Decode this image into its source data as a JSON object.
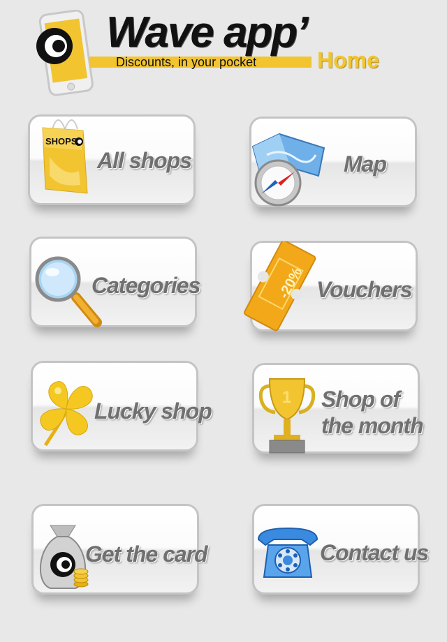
{
  "header": {
    "brand_title": "Wave app’",
    "tagline": "Discounts, in your pocket",
    "page_label": "Home",
    "accent_color": "#f2c430"
  },
  "tiles": [
    {
      "label": "All  shops",
      "icon": "shopping-bag-icon",
      "bag_text": "SHOPS"
    },
    {
      "label": "Map",
      "icon": "map-compass-icon"
    },
    {
      "label": "Categories",
      "icon": "magnifier-icon"
    },
    {
      "label": "Vouchers",
      "icon": "voucher-ticket-icon",
      "ticket_text": "-20%"
    },
    {
      "label": "Lucky shop",
      "icon": "four-leaf-clover-icon"
    },
    {
      "label_line1": "Shop of",
      "label_line2": "the month",
      "icon": "trophy-icon",
      "trophy_text": "1"
    },
    {
      "label": "Get the card",
      "icon": "money-bag-icon"
    },
    {
      "label": "Contact us",
      "icon": "telephone-icon"
    }
  ]
}
